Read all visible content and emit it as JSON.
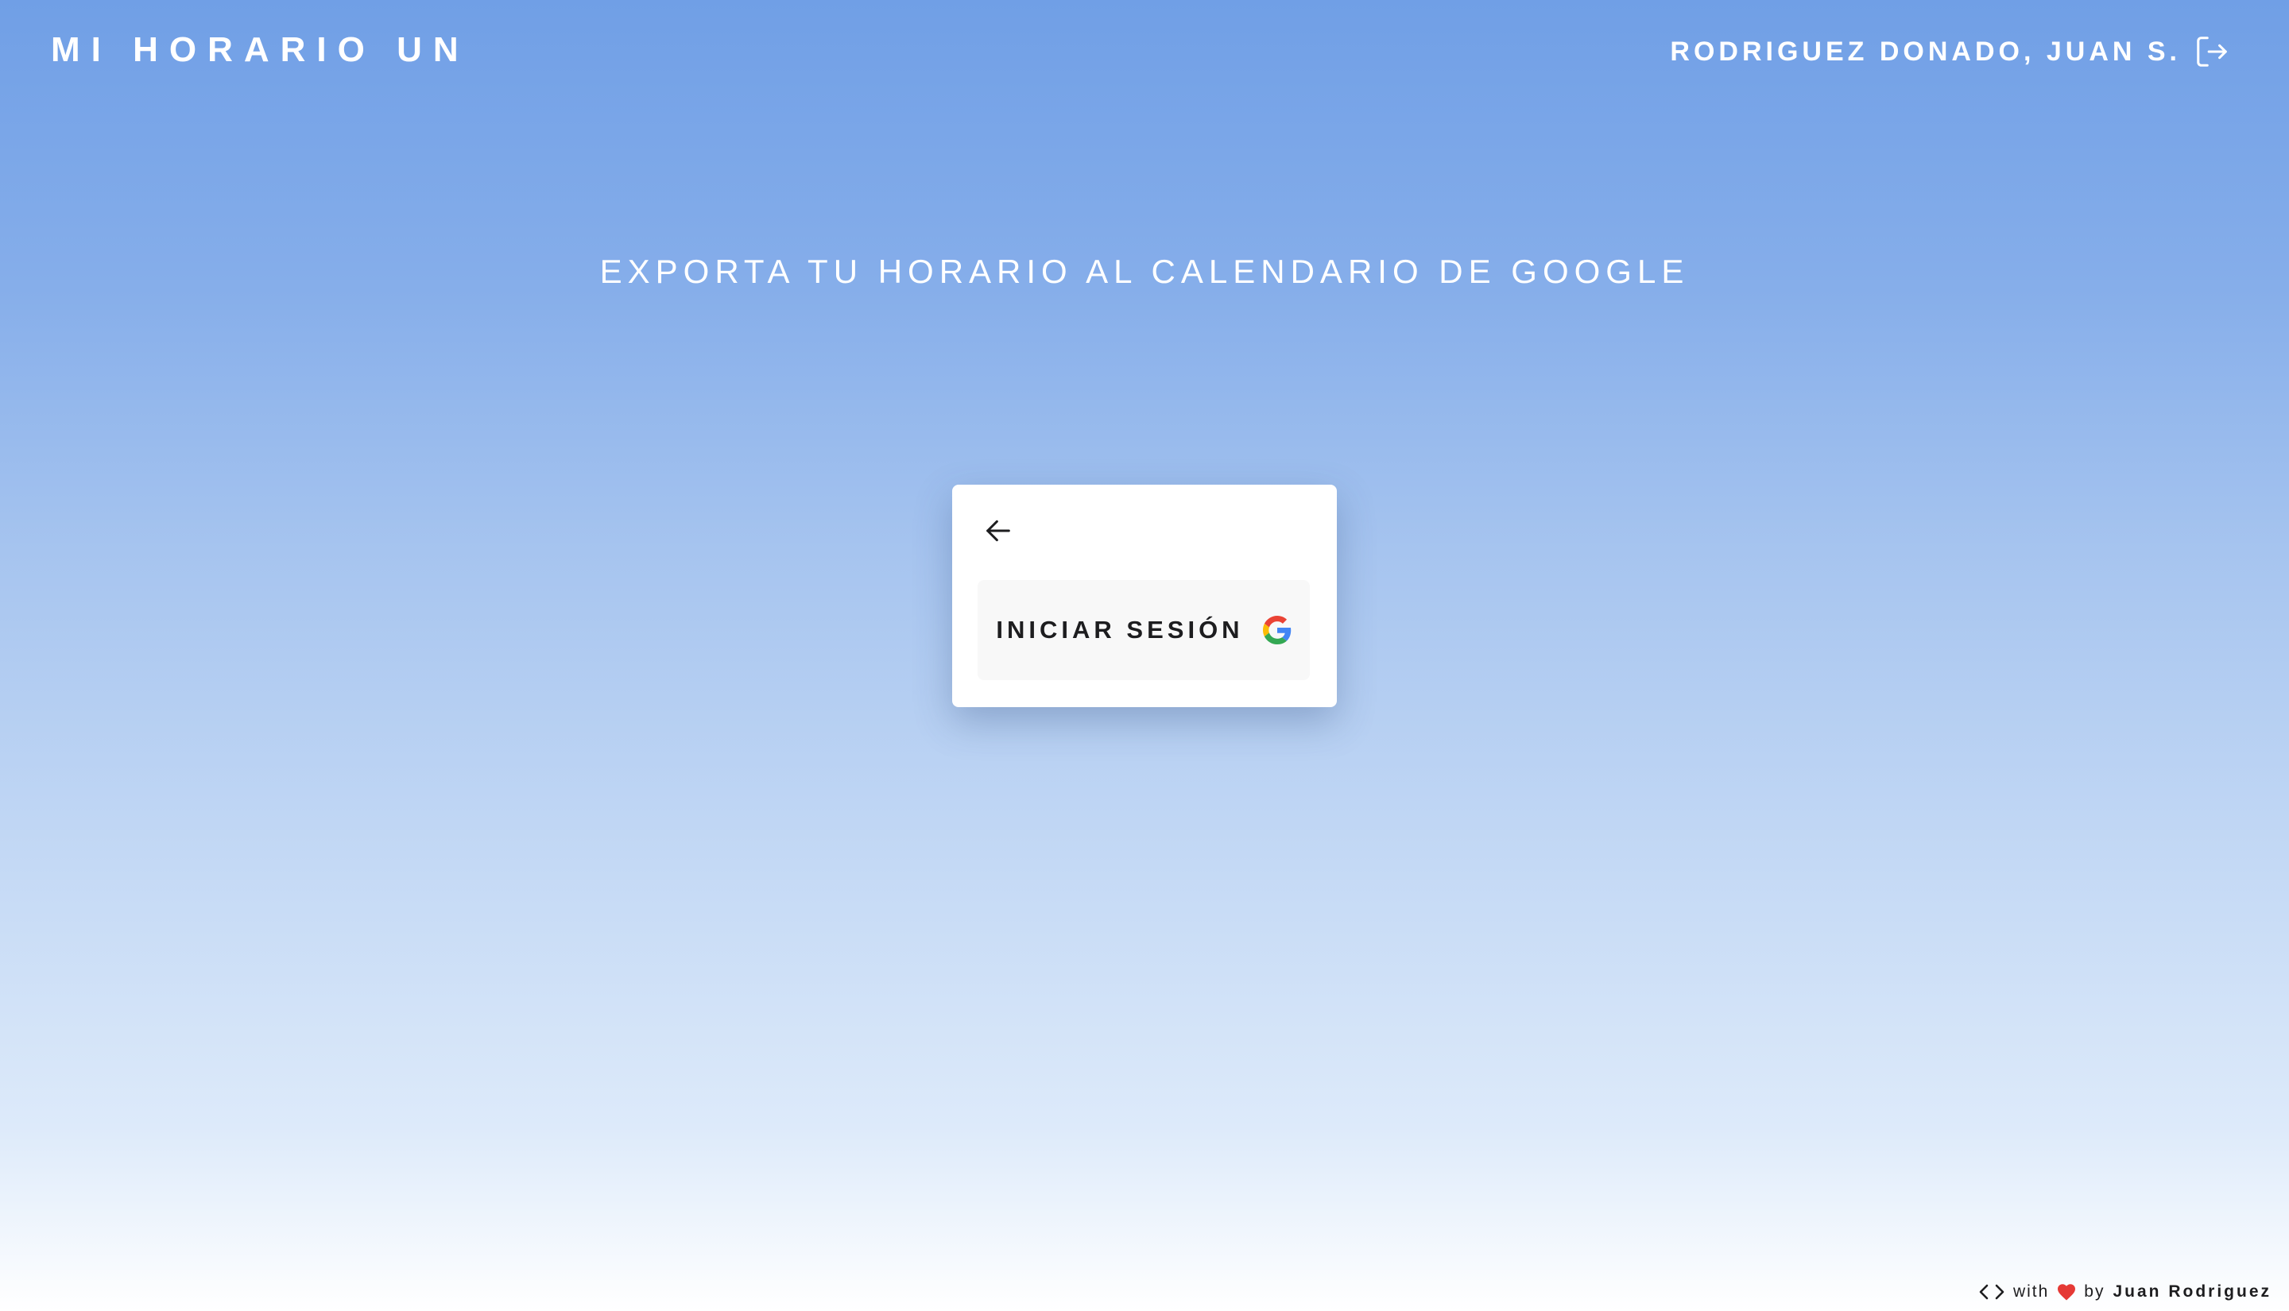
{
  "header": {
    "app_title": "MI HORARIO UN",
    "user_name": "RODRIGUEZ DONADO, JUAN S.",
    "logout_icon": "logout-icon"
  },
  "main": {
    "heading": "EXPORTA TU HORARIO AL CALENDARIO DE GOOGLE"
  },
  "card": {
    "back_icon": "arrow-left-icon",
    "signin_label": "INICIAR SESIÓN",
    "signin_icon": "google-logo-icon"
  },
  "footer": {
    "code_icon": "code-icon",
    "with_text": "with",
    "heart_icon": "heart-icon",
    "by_text": "by",
    "author": "Juan Rodriguez"
  },
  "colors": {
    "gradient_top": "#709fe6",
    "gradient_bottom": "#ffffff",
    "heart": "#e53935"
  }
}
